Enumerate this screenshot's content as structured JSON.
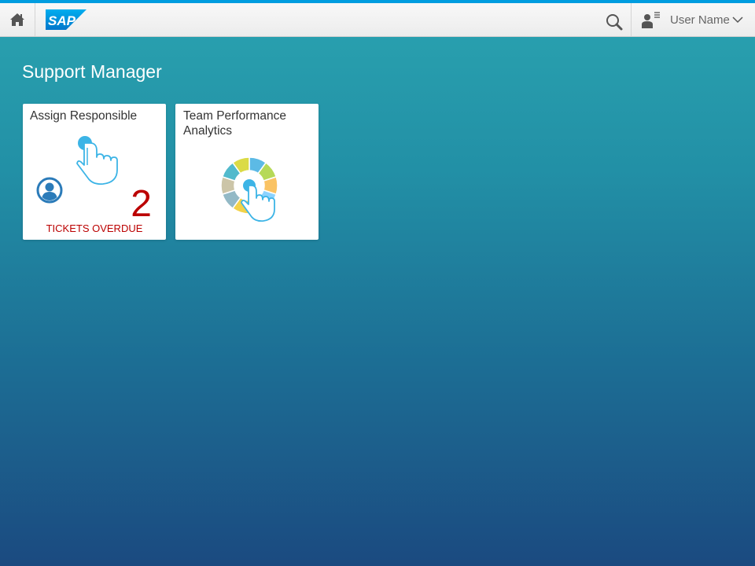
{
  "shell": {
    "logo_text": "SAP",
    "user_name": "User Name",
    "icons": {
      "home": "home-icon",
      "search": "search-icon",
      "user": "user-menu-icon",
      "caret": "chevron-down-icon"
    }
  },
  "page": {
    "title": "Support Manager"
  },
  "tiles": [
    {
      "title": "Assign Responsible",
      "kpi_value": "2",
      "kpi_label": "TICKETS OVERDUE",
      "icons": [
        "tap-gesture-icon",
        "person-icon"
      ]
    },
    {
      "title": "Team Performance Analytics",
      "icons": [
        "donut-chart-icon",
        "tap-gesture-icon"
      ]
    }
  ],
  "colors": {
    "accent": "#009de0",
    "kpi_critical": "#bb0000",
    "background_top": "#2aa3b0",
    "background_bottom": "#1b4a80",
    "donut_segments": [
      "#5cbae5",
      "#b6d957",
      "#fac364",
      "#8cd3ff",
      "#d998cb",
      "#f2d249",
      "#93b9c6",
      "#ccc5a8",
      "#52bacc",
      "#dbdb46"
    ]
  }
}
